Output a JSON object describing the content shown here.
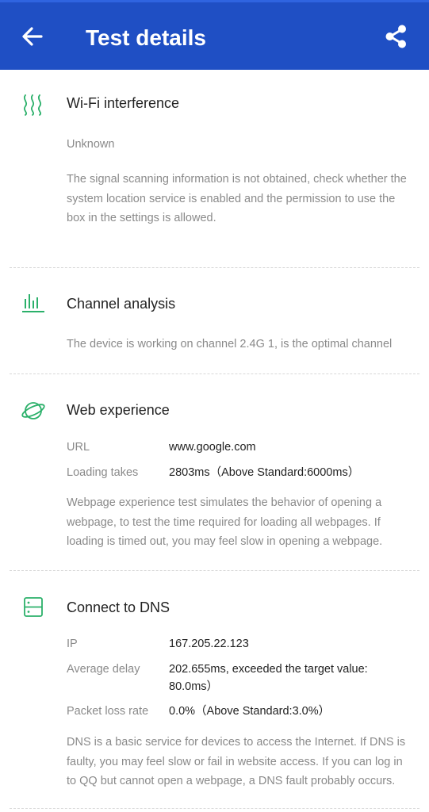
{
  "appbar": {
    "title": "Test details"
  },
  "icons": {
    "back": "arrow-back-icon",
    "share": "share-icon"
  },
  "colors": {
    "appbar": "#1f4fc4",
    "accent": "#2bb06a"
  },
  "wifi": {
    "title": "Wi-Fi interference",
    "status": "Unknown",
    "description": "The signal scanning information is not obtained, check whether the system location service is enabled and the permission to use the box in the settings is allowed."
  },
  "channel": {
    "title": "Channel analysis",
    "description": "The device is working on channel 2.4G 1, is the optimal channel"
  },
  "web": {
    "title": "Web experience",
    "url_label": "URL",
    "url_value": "www.google.com",
    "loading_label": "Loading takes",
    "loading_value": "2803ms（Above Standard:6000ms）",
    "description": "Webpage experience test simulates the behavior of opening a webpage, to test the time required for loading all webpages. If loading is timed out, you may feel slow in opening a webpage."
  },
  "dns": {
    "title": "Connect to DNS",
    "ip_label": "IP",
    "ip_value": "167.205.22.123",
    "delay_label": "Average delay",
    "delay_value": "202.655ms, exceeded the target value: 80.0ms）",
    "loss_label": "Packet loss rate",
    "loss_value": "0.0%（Above Standard:3.0%）",
    "description": "DNS is a basic service for devices to access the Internet. If DNS is faulty, you may feel slow or fail in website access. If you can log in to QQ but cannot open a webpage, a DNS fault probably occurs."
  }
}
